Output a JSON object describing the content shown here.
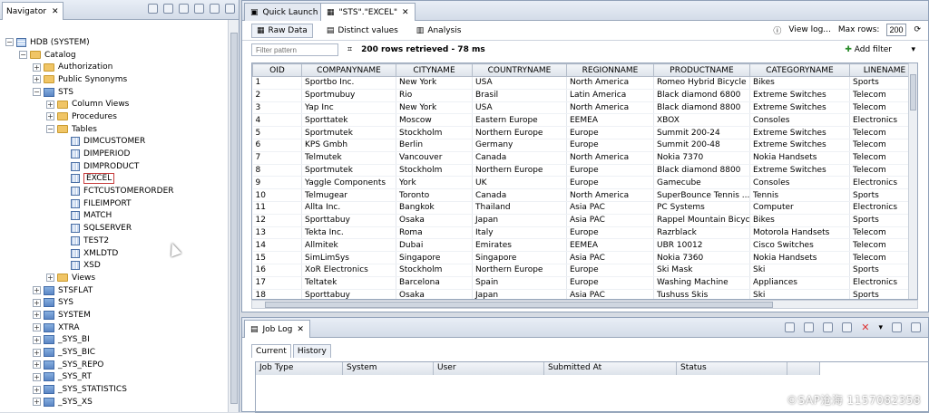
{
  "navigator": {
    "tab_label": "Navigator",
    "tree": [
      {
        "label": "HDB (SYSTEM)",
        "indent": 0,
        "exp": "-",
        "icon": "db"
      },
      {
        "label": "Catalog",
        "indent": 1,
        "exp": "-",
        "icon": "folder"
      },
      {
        "label": "Authorization",
        "indent": 2,
        "exp": "+",
        "icon": "folder"
      },
      {
        "label": "Public Synonyms",
        "indent": 2,
        "exp": "+",
        "icon": "folder"
      },
      {
        "label": "STS",
        "indent": 2,
        "exp": "-",
        "icon": "schema"
      },
      {
        "label": "Column Views",
        "indent": 3,
        "exp": "+",
        "icon": "folder"
      },
      {
        "label": "Procedures",
        "indent": 3,
        "exp": "+",
        "icon": "folder"
      },
      {
        "label": "Tables",
        "indent": 3,
        "exp": "-",
        "icon": "folder"
      },
      {
        "label": "DIMCUSTOMER",
        "indent": 4,
        "exp": "",
        "icon": "table"
      },
      {
        "label": "DIMPERIOD",
        "indent": 4,
        "exp": "",
        "icon": "table"
      },
      {
        "label": "DIMPRODUCT",
        "indent": 4,
        "exp": "",
        "icon": "table"
      },
      {
        "label": "EXCEL",
        "indent": 4,
        "exp": "",
        "icon": "table",
        "selected": true
      },
      {
        "label": "FCTCUSTOMERORDER",
        "indent": 4,
        "exp": "",
        "icon": "table"
      },
      {
        "label": "FILEIMPORT",
        "indent": 4,
        "exp": "",
        "icon": "table"
      },
      {
        "label": "MATCH",
        "indent": 4,
        "exp": "",
        "icon": "table"
      },
      {
        "label": "SQLSERVER",
        "indent": 4,
        "exp": "",
        "icon": "table"
      },
      {
        "label": "TEST2",
        "indent": 4,
        "exp": "",
        "icon": "table"
      },
      {
        "label": "XMLDTD",
        "indent": 4,
        "exp": "",
        "icon": "table"
      },
      {
        "label": "XSD",
        "indent": 4,
        "exp": "",
        "icon": "table"
      },
      {
        "label": "Views",
        "indent": 3,
        "exp": "+",
        "icon": "folder"
      },
      {
        "label": "STSFLAT",
        "indent": 2,
        "exp": "+",
        "icon": "schema"
      },
      {
        "label": "SYS",
        "indent": 2,
        "exp": "+",
        "icon": "schema"
      },
      {
        "label": "SYSTEM",
        "indent": 2,
        "exp": "+",
        "icon": "schema"
      },
      {
        "label": "XTRA",
        "indent": 2,
        "exp": "+",
        "icon": "schema"
      },
      {
        "label": "_SYS_BI",
        "indent": 2,
        "exp": "+",
        "icon": "schema"
      },
      {
        "label": "_SYS_BIC",
        "indent": 2,
        "exp": "+",
        "icon": "schema"
      },
      {
        "label": "_SYS_REPO",
        "indent": 2,
        "exp": "+",
        "icon": "schema"
      },
      {
        "label": "_SYS_RT",
        "indent": 2,
        "exp": "+",
        "icon": "schema"
      },
      {
        "label": "_SYS_STATISTICS",
        "indent": 2,
        "exp": "+",
        "icon": "schema"
      },
      {
        "label": "_SYS_XS",
        "indent": 2,
        "exp": "+",
        "icon": "schema"
      }
    ]
  },
  "editor": {
    "tabs": [
      {
        "label": "Quick Launch"
      },
      {
        "label": "\"STS\".\"EXCEL\"",
        "active": true
      }
    ],
    "subtabs": [
      {
        "label": "Raw Data",
        "active": true
      },
      {
        "label": "Distinct values"
      },
      {
        "label": "Analysis"
      }
    ],
    "view_log_label": "View log...",
    "max_rows_label": "Max rows:",
    "max_rows_value": "200",
    "filter_placeholder": "Filter pattern",
    "retrieved_text": "200 rows retrieved - 78 ms",
    "add_filter_label": "Add filter",
    "columns": [
      "OID",
      "COMPANYNAME",
      "CITYNAME",
      "COUNTRYNAME",
      "REGIONNAME",
      "PRODUCTNAME",
      "CATEGORYNAME",
      "LINENAME"
    ],
    "row_markers": [
      "12",
      "ABC",
      "ABC",
      "ABC",
      "ABC",
      "ABC",
      "ABC",
      "ABC"
    ],
    "rows": [
      [
        "1",
        "Sportbo Inc.",
        "New York",
        "USA",
        "North America",
        "Romeo Hybrid Bicycle",
        "Bikes",
        "Sports"
      ],
      [
        "2",
        "Sportmubuy",
        "Rio",
        "Brasil",
        "Latin America",
        "Black diamond 6800",
        "Extreme Switches",
        "Telecom"
      ],
      [
        "3",
        "Yap Inc",
        "New York",
        "USA",
        "North America",
        "Black diamond 8800",
        "Extreme Switches",
        "Telecom"
      ],
      [
        "4",
        "Sporttatek",
        "Moscow",
        "Eastern Europe",
        "EEMEA",
        "XBOX",
        "Consoles",
        "Electronics"
      ],
      [
        "5",
        "Sportmutek",
        "Stockholm",
        "Northern Europe",
        "Europe",
        "Summit 200-24",
        "Extreme Switches",
        "Telecom"
      ],
      [
        "6",
        "KPS Gmbh",
        "Berlin",
        "Germany",
        "Europe",
        "Summit 200-48",
        "Extreme Switches",
        "Telecom"
      ],
      [
        "7",
        "Telmutek",
        "Vancouver",
        "Canada",
        "North America",
        "Nokia 7370",
        "Nokia Handsets",
        "Telecom"
      ],
      [
        "8",
        "Sportmutek",
        "Stockholm",
        "Northern Europe",
        "Europe",
        "Black diamond 8800",
        "Extreme Switches",
        "Telecom"
      ],
      [
        "9",
        "Yaggle Components",
        "York",
        "UK",
        "Europe",
        "Gamecube",
        "Consoles",
        "Electronics"
      ],
      [
        "10",
        "Telmugear",
        "Toronto",
        "Canada",
        "North America",
        "SuperBounce Tennis ...",
        "Tennis",
        "Sports"
      ],
      [
        "11",
        "Allta Inc.",
        "Bangkok",
        "Thailand",
        "Asia PAC",
        "PC Systems",
        "Computer",
        "Electronics"
      ],
      [
        "12",
        "Sporttabuy",
        "Osaka",
        "Japan",
        "Asia PAC",
        "Rappel Mountain Bicycle",
        "Bikes",
        "Sports"
      ],
      [
        "13",
        "Tekta Inc.",
        "Roma",
        "Italy",
        "Europe",
        "Razrblack",
        "Motorola Handsets",
        "Telecom"
      ],
      [
        "14",
        "Allmitek",
        "Dubai",
        "Emirates",
        "EEMEA",
        "UBR 10012",
        "Cisco Switches",
        "Telecom"
      ],
      [
        "15",
        "SimLimSys",
        "Singapore",
        "Singapore",
        "Asia PAC",
        "Nokia 7360",
        "Nokia Handsets",
        "Telecom"
      ],
      [
        "16",
        "XoR Electronics",
        "Stockholm",
        "Northern Europe",
        "Europe",
        "Ski Mask",
        "Ski",
        "Sports"
      ],
      [
        "17",
        "Teltatek",
        "Barcelona",
        "Spain",
        "Europe",
        "Washing Machine",
        "Appliances",
        "Electronics"
      ],
      [
        "18",
        "Sporttabuy",
        "Osaka",
        "Japan",
        "Asia PAC",
        "Tushuss Skis",
        "Ski",
        "Sports"
      ]
    ]
  },
  "joblog": {
    "tab_label": "Job Log",
    "subtabs": [
      {
        "label": "Current",
        "active": true
      },
      {
        "label": "History"
      }
    ],
    "columns": [
      "Job Type",
      "System",
      "User",
      "Submitted At",
      "Status"
    ]
  },
  "watermark": "©SAP沧海 1157082358",
  "colors": {
    "selection_outline": "#c63b3b",
    "panel_border": "#8fa0b8"
  }
}
